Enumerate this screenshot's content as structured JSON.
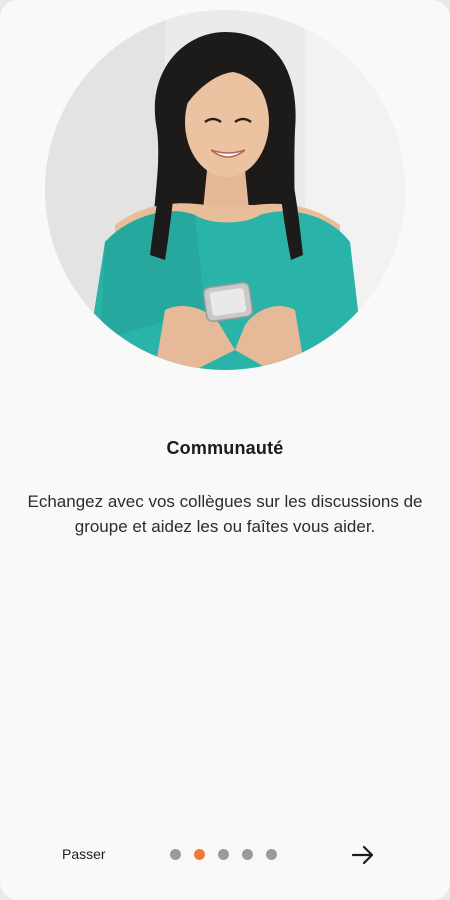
{
  "onboarding": {
    "title": "Communauté",
    "description": "Echangez avec vos collègues sur les discussions de groupe et aidez les ou faîtes vous aider.",
    "skip_label": "Passer",
    "pagination": {
      "total": 5,
      "active_index": 1
    },
    "next_icon": "arrow-right-icon",
    "accent_color": "#f07a3a",
    "dot_color": "#9a9a9a"
  }
}
